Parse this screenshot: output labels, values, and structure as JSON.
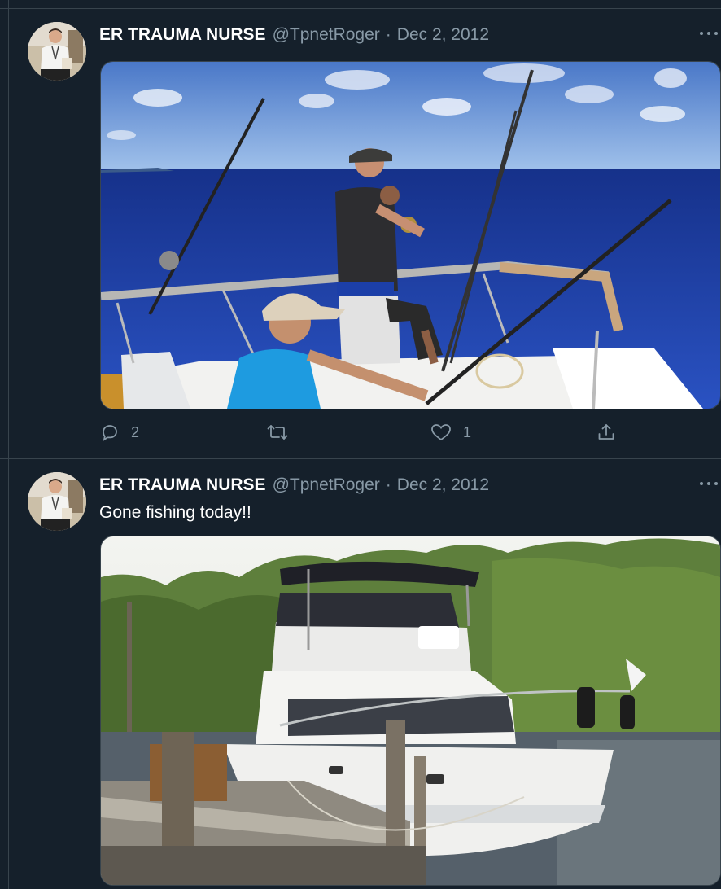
{
  "tweets": [
    {
      "author_name": "ER TRAUMA NURSE",
      "handle": "@TpnetRoger",
      "separator": "·",
      "date": "Dec 2, 2012",
      "text": "",
      "media_description": "fishing-boat-photo",
      "reply_count": "2",
      "retweet_count": "",
      "like_count": "1"
    },
    {
      "author_name": "ER TRAUMA NURSE",
      "handle": "@TpnetRoger",
      "separator": "·",
      "date": "Dec 2, 2012",
      "text": "Gone fishing today!!",
      "media_description": "docked-yacht-photo"
    }
  ],
  "colors": {
    "background": "#15202b",
    "secondary_text": "#8899a6",
    "border": "#38444d",
    "primary_text": "#ffffff"
  },
  "icons": {
    "reply": "reply-icon",
    "retweet": "retweet-icon",
    "like": "heart-icon",
    "share": "share-icon",
    "more": "more-icon"
  }
}
